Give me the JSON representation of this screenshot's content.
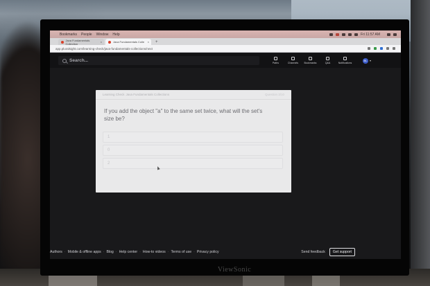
{
  "browser": {
    "menubar": [
      "Bookmarks",
      "People",
      "Window",
      "Help"
    ],
    "clock": "Fri 11:57 AM",
    "tabs": [
      {
        "label": "Java Fundamentals Collection"
      },
      {
        "label": "Java Fundamentals Colle"
      }
    ],
    "url": "app.pluralsight.com/learning-check/java-fundamentals-collections/next"
  },
  "appnav": {
    "search_placeholder": "Search...",
    "items": [
      {
        "label": "Paths",
        "icon": "paths-icon"
      },
      {
        "label": "Channels",
        "icon": "channels-icon"
      },
      {
        "label": "Bookmarks",
        "icon": "bookmarks-icon"
      },
      {
        "label": "Q&A",
        "icon": "qa-icon"
      },
      {
        "label": "Notifications",
        "icon": "bell-icon"
      }
    ],
    "avatar_initials": "BL"
  },
  "card": {
    "breadcrumb_prefix": "Learning Check",
    "breadcrumb_course": "Java Fundamentals Collections",
    "counter": "Question 3/10",
    "question": "If you add the object \"a\" to the same set twice, what will the set's size be?",
    "options": [
      "1",
      "0",
      "2"
    ]
  },
  "footer": {
    "links": [
      "Authors",
      "Mobile & offline apps",
      "Blog",
      "Help center",
      "How-to videos",
      "Terms of use",
      "Privacy policy"
    ],
    "feedback": "Send feedback",
    "support": "Get support"
  },
  "monitor_brand": "ViewSonic"
}
